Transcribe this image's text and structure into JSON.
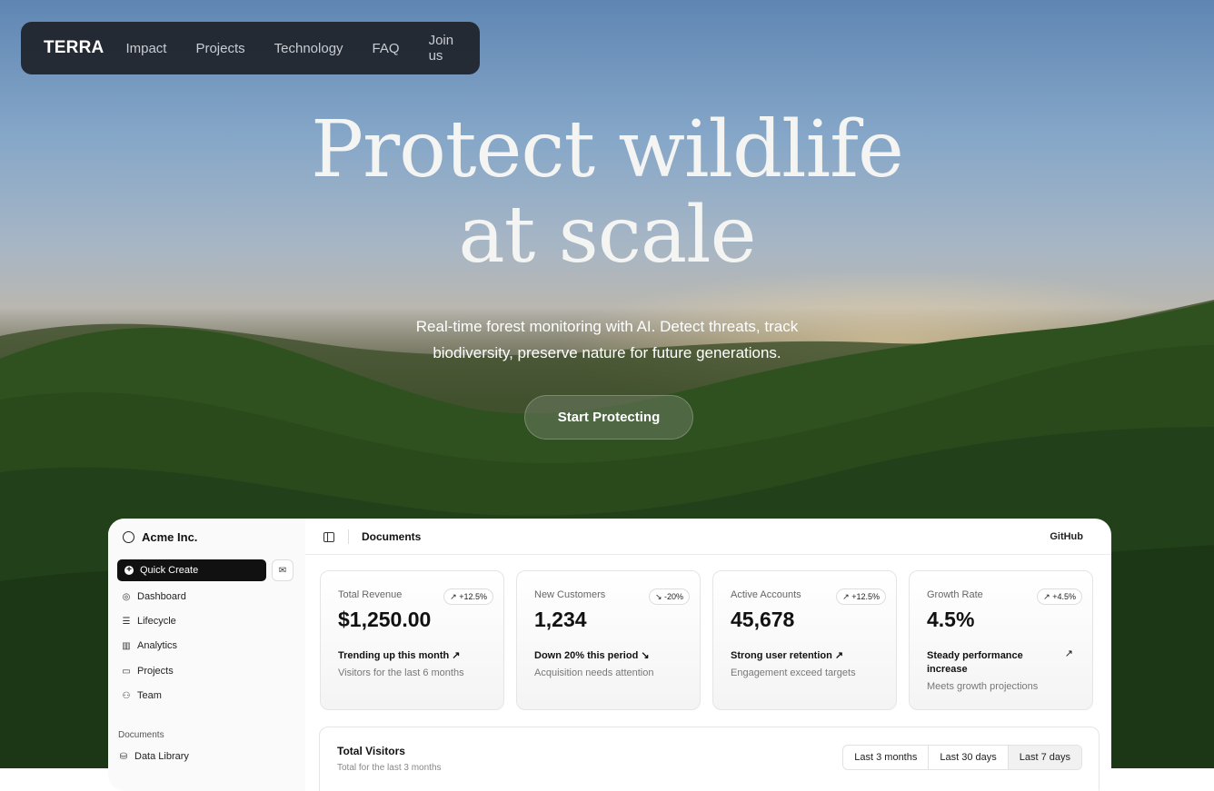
{
  "nav": {
    "brand": "TERRA",
    "links": [
      "Impact",
      "Projects",
      "Technology",
      "FAQ",
      "Join us"
    ]
  },
  "hero": {
    "title_line1": "Protect wildlife",
    "title_line2": "at scale",
    "subtitle_line1": "Real-time forest monitoring with AI. Detect threats, track",
    "subtitle_line2": "biodiversity, preserve nature for future generations.",
    "cta": "Start Protecting"
  },
  "dashboard": {
    "org": "Acme Inc.",
    "quick_create": "Quick Create",
    "sidebar": [
      {
        "label": "Dashboard",
        "icon": "dashboard-icon"
      },
      {
        "label": "Lifecycle",
        "icon": "list-icon"
      },
      {
        "label": "Analytics",
        "icon": "chart-icon"
      },
      {
        "label": "Projects",
        "icon": "folder-icon"
      },
      {
        "label": "Team",
        "icon": "users-icon"
      }
    ],
    "documents_group": "Documents",
    "documents_items": [
      {
        "label": "Data Library",
        "icon": "database-icon"
      }
    ],
    "header_title": "Documents",
    "github": "GitHub",
    "cards": [
      {
        "label": "Total Revenue",
        "badge": "+12.5%",
        "value": "$1,250.00",
        "trend": "Trending up this month",
        "note": "Visitors for the last 6 months"
      },
      {
        "label": "New Customers",
        "badge": "-20%",
        "value": "1,234",
        "trend": "Down 20% this period",
        "note": "Acquisition needs attention"
      },
      {
        "label": "Active Accounts",
        "badge": "+12.5%",
        "value": "45,678",
        "trend": "Strong user retention",
        "note": "Engagement exceed targets"
      },
      {
        "label": "Growth Rate",
        "badge": "+4.5%",
        "value": "4.5%",
        "trend": "Steady performance increase",
        "note": "Meets growth projections"
      }
    ],
    "visitors": {
      "title": "Total Visitors",
      "subtitle": "Total for the last 3 months",
      "ranges": [
        "Last 3 months",
        "Last 30 days",
        "Last 7 days"
      ],
      "selected": "Last 7 days"
    }
  }
}
